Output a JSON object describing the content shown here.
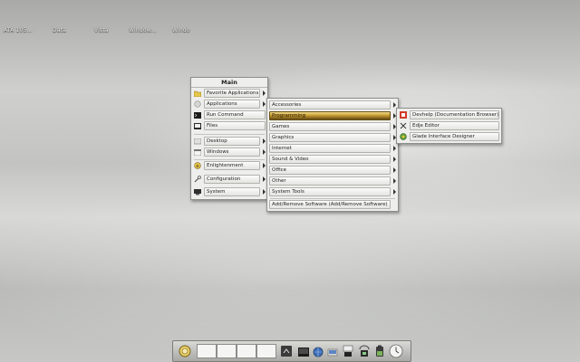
{
  "desktop": {
    "icons": [
      "ATA 105...",
      "Data",
      "Vista",
      "Window...",
      "Windo"
    ]
  },
  "main_menu": {
    "title": "Main",
    "items": [
      {
        "label": "Favorite Applications",
        "icon": "star-folder-icon"
      },
      {
        "label": "Applications",
        "icon": "applications-icon"
      },
      {
        "label": "Run Command",
        "icon": "terminal-icon"
      },
      {
        "label": "Files",
        "icon": "file-manager-icon"
      },
      {
        "label": "Desktop",
        "icon": "desktop-icon"
      },
      {
        "label": "Windows",
        "icon": "windows-icon"
      },
      {
        "label": "Enlightenment",
        "icon": "enlightenment-icon"
      },
      {
        "label": "Configuration",
        "icon": "wrench-icon"
      },
      {
        "label": "System",
        "icon": "system-icon"
      }
    ]
  },
  "applications_menu": {
    "items": [
      {
        "label": "Accessories"
      },
      {
        "label": "Programming"
      },
      {
        "label": "Games"
      },
      {
        "label": "Graphics"
      },
      {
        "label": "Internet"
      },
      {
        "label": "Sound & Video"
      },
      {
        "label": "Office"
      },
      {
        "label": "Other"
      },
      {
        "label": "System Tools"
      },
      {
        "label": "Add/Remove Software (Add/Remove Software)"
      }
    ],
    "selected": "Programming"
  },
  "programming_menu": {
    "items": [
      {
        "label": "Devhelp (Documentation Browser)",
        "icon": "devhelp-icon"
      },
      {
        "label": "Edje Editor",
        "icon": "edje-icon"
      },
      {
        "label": "Glade Interface Designer",
        "icon": "glade-icon"
      }
    ]
  },
  "taskbar": {
    "icons": [
      "start-icon",
      "pager",
      "mixer-icon",
      "terminal-icon",
      "browser-icon",
      "filemanager-icon",
      "cpu-icon",
      "temperature-icon",
      "battery-icon",
      "clock-icon"
    ]
  },
  "colors": {
    "selected_item": "#c89a2f",
    "menu_bg": "#eeeeec"
  }
}
